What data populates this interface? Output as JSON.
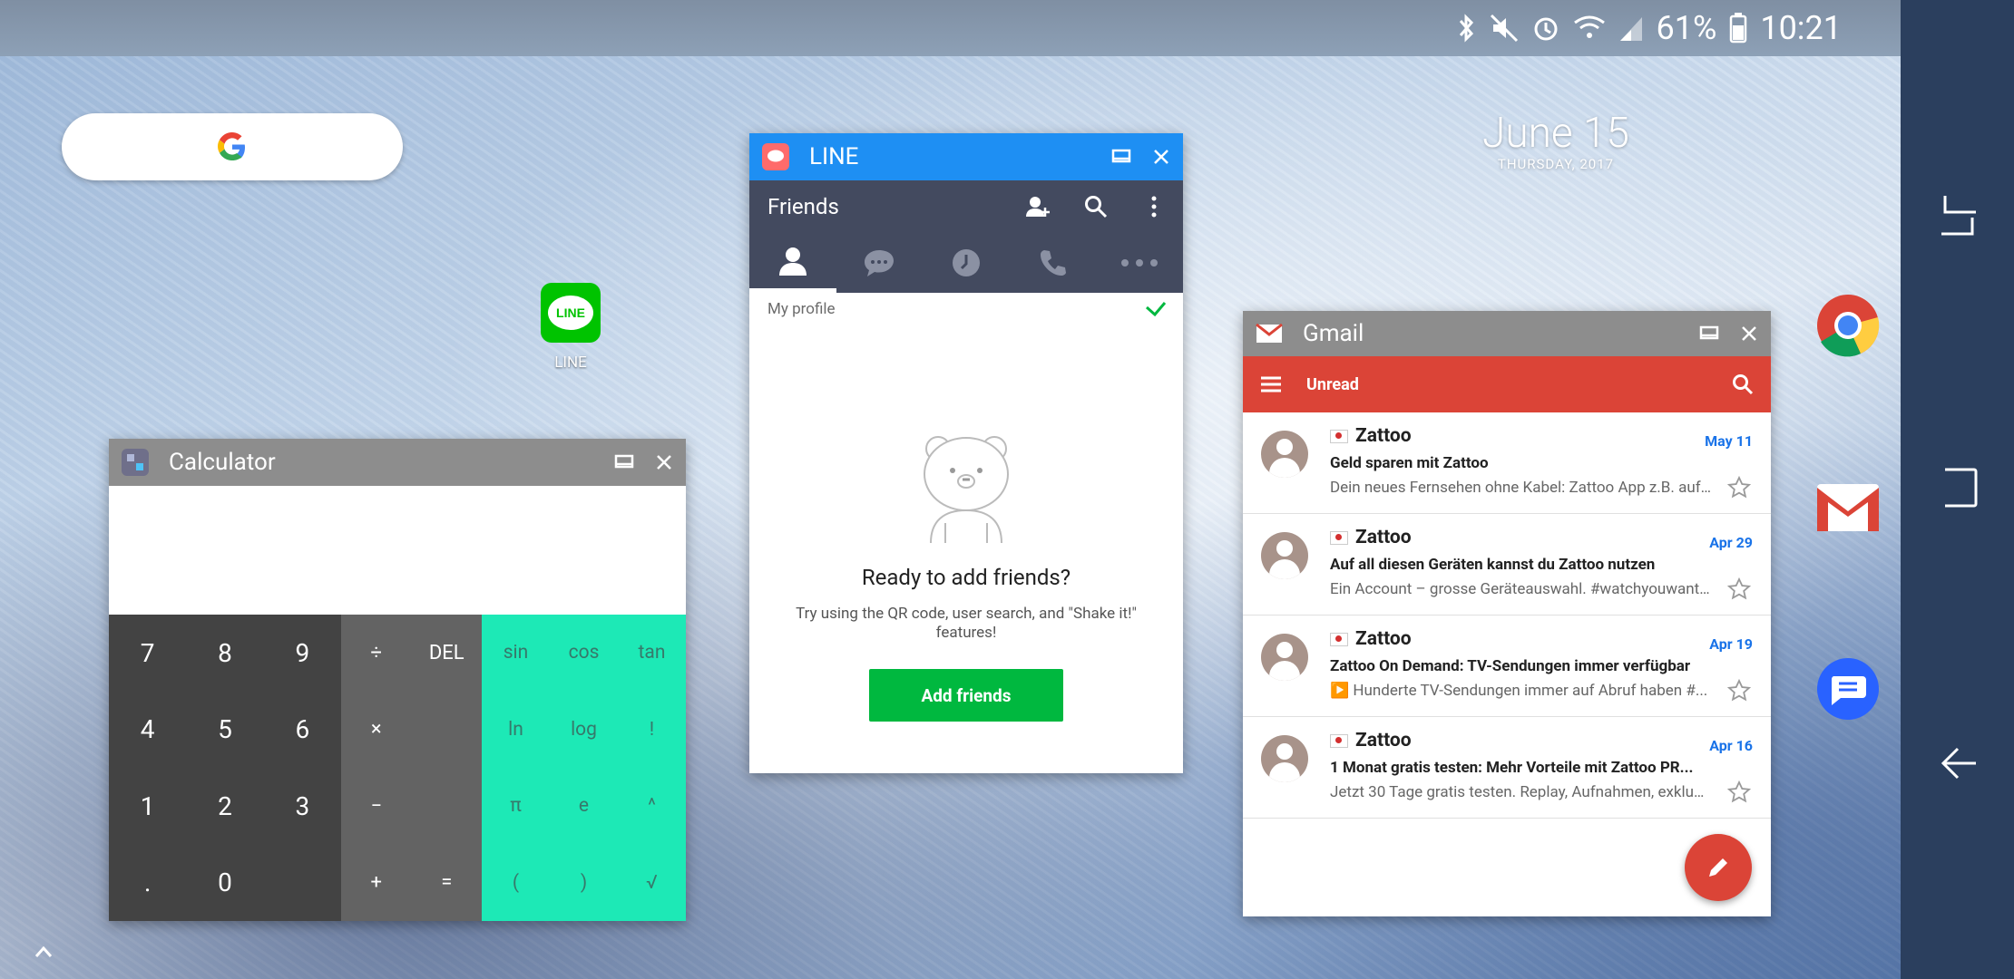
{
  "status_bar": {
    "battery": "61%",
    "time": "10:21"
  },
  "desktop": {
    "google_logo": "G",
    "line_icon_label": "LINE",
    "line_icon_text": "LINE",
    "clock": {
      "date": "June 15",
      "day": "THURSDAY, 2017"
    }
  },
  "calculator": {
    "title": "Calculator",
    "num_keys": [
      "7",
      "8",
      "9",
      "4",
      "5",
      "6",
      "1",
      "2",
      "3",
      ".",
      "0",
      ""
    ],
    "op_keys": [
      "÷",
      "DEL",
      "×",
      "",
      "−",
      "",
      "+",
      "="
    ],
    "sci_keys": [
      "sin",
      "cos",
      "tan",
      "ln",
      "log",
      "!",
      "π",
      "e",
      "^",
      "(",
      ")",
      "√"
    ],
    "colors": {
      "num_pad": "#434343",
      "op_pad": "#636363",
      "sci_pad": "#1de9b6"
    }
  },
  "line_app": {
    "title": "LINE",
    "header": "Friends",
    "tabs": [
      "friends-tab",
      "chats-tab",
      "timeline-tab",
      "calls-tab",
      "more-tab"
    ],
    "my_profile": "My profile",
    "ready_title": "Ready to add friends?",
    "ready_subtitle": "Try using the QR code, user search, and \"Shake it!\" features!",
    "add_button": "Add friends",
    "colors": {
      "titlebar": "#1e8ff3",
      "header": "#434a5f",
      "button": "#00b83f"
    }
  },
  "gmail": {
    "title": "Gmail",
    "folder": "Unread",
    "mails": [
      {
        "sender": "Zattoo",
        "date": "May 11",
        "subject": "Geld sparen mit Zattoo",
        "snippet": "Dein neues Fernsehen ohne Kabel: Zattoo App z.B. auf..."
      },
      {
        "sender": "Zattoo",
        "date": "Apr 29",
        "subject": "Auf all diesen Geräten kannst du Zattoo nutzen",
        "snippet": "Ein Account – grosse Geräteauswahl. #watchyouwant..."
      },
      {
        "sender": "Zattoo",
        "date": "Apr 19",
        "subject": "Zattoo On Demand: TV-Sendungen immer verfügbar",
        "snippet": "▶️ Hunderte TV-Sendungen immer auf Abruf haben #..."
      },
      {
        "sender": "Zattoo",
        "date": "Apr 16",
        "subject": "1 Monat gratis testen: Mehr Vorteile mit Zattoo PR...",
        "snippet": "Jetzt 30 Tage gratis testen. Replay, Aufnahmen, exklusi..."
      }
    ],
    "colors": {
      "bar": "#db4437",
      "date": "#1a73e8"
    }
  },
  "side_apps": [
    "chrome-icon",
    "gmail-icon",
    "messages-icon"
  ]
}
